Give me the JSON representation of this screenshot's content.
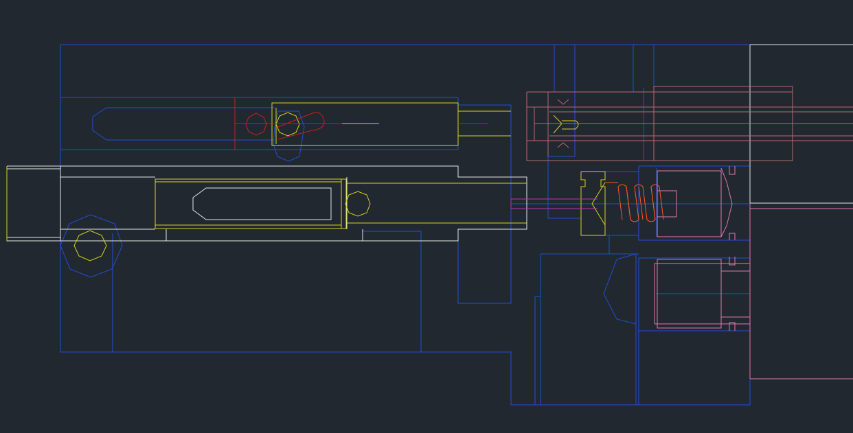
{
  "app": {
    "view": "model-space"
  },
  "colors": {
    "background": "#212830",
    "blue": "#1f4fd8",
    "white": "#e8e8ea",
    "yellow": "#d9d320",
    "red": "#c8201c",
    "brown": "#b86a6e",
    "magenta": "#c030b8",
    "pink": "#e07ab0",
    "orange": "#ff5a2a"
  }
}
